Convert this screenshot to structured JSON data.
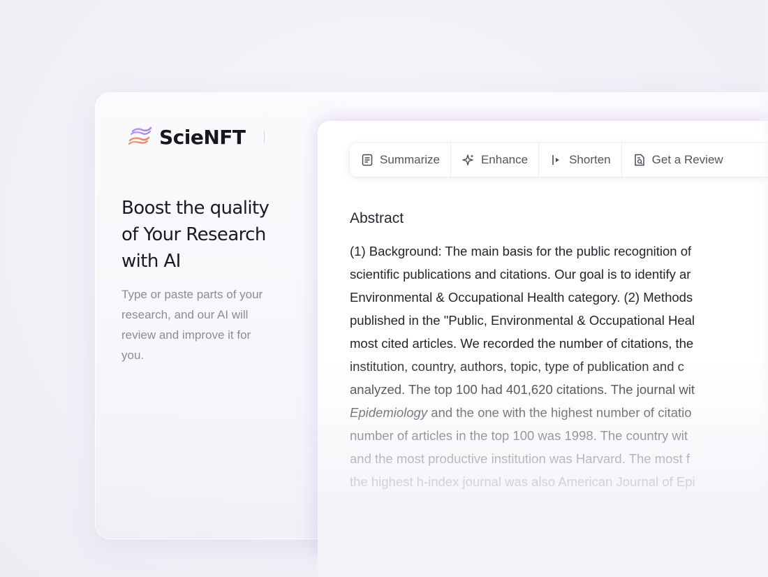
{
  "brand": {
    "name": "ScieNFT",
    "logo_icon": "scienft-logo-icon"
  },
  "hero": {
    "headline_lines": [
      "Boost the quality",
      "of Your Research",
      "with AI"
    ],
    "subtext_lines": [
      "Type or paste parts of your",
      "research, and our AI will",
      "review and improve it for",
      "you."
    ]
  },
  "toolbar": {
    "summarize": {
      "label": "Summarize",
      "icon": "document-icon"
    },
    "enhance": {
      "label": "Enhance",
      "icon": "sparkle-icon"
    },
    "shorten": {
      "label": "Shorten",
      "icon": "shorten-icon"
    },
    "review": {
      "label": "Get a Review",
      "icon": "review-doc-icon"
    }
  },
  "editor": {
    "title": "Abstract",
    "lines": [
      "(1) Background: The main basis for the public recognition of",
      "scientific publications and citations. Our goal is to identify ar",
      "Environmental & Occupational Health category. (2) Methods",
      "published in the \"Public, Environmental & Occupational Heal",
      "most cited articles. We recorded the number of citations, the",
      "institution, country, authors, topic, type of publication and c",
      "analyzed. The top 100 had 401,620 citations. The journal wit",
      "",
      "number of articles in the top 100 was 1998. The country wit",
      "and the most productive institution was Harvard. The most f",
      "the highest h-index journal was also American Journal of Epi"
    ],
    "line7_italic": "Epidemiology",
    "line7_rest": " and the one with the highest number of citatio"
  },
  "colors": {
    "brand_purple": "#b98cf2",
    "brand_orange": "#f08a5d",
    "text_dark": "#1b1a22",
    "text_muted": "#8d8b96"
  }
}
